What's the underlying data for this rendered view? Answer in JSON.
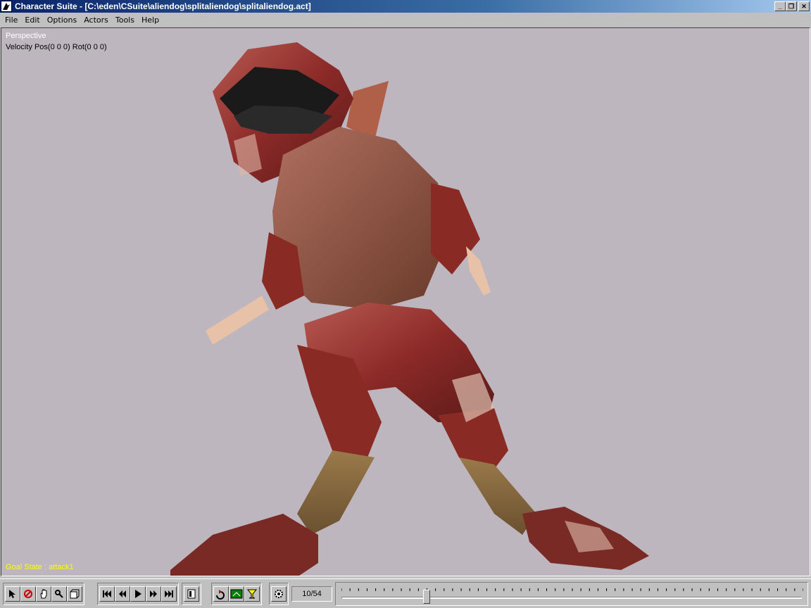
{
  "window": {
    "title": "Character Suite - [C:\\eden\\CSuite\\aliendog\\splitaliendog\\splitaliendog.act]",
    "icon": "character-suite-icon",
    "minimize": "_",
    "maximize": "❐",
    "close": "✕"
  },
  "menu": {
    "file": "File",
    "edit": "Edit",
    "options": "Options",
    "actors": "Actors",
    "tools": "Tools",
    "help": "Help"
  },
  "viewport": {
    "mode": "Perspective",
    "velocity": "Velocity Pos(0 0 0) Rot(0 0 0)",
    "goal_state": "Goal State : attack1",
    "background": "#beb6be"
  },
  "toolbar": {
    "frame_counter": "10/54",
    "tools": [
      "select-arrow-icon",
      "rotate-icon",
      "pan-hand-icon",
      "zoom-icon",
      "box-icon"
    ],
    "playback": [
      "first-frame-icon",
      "step-back-icon",
      "play-icon",
      "step-forward-icon",
      "last-frame-icon"
    ],
    "timeline_progress": 0.185
  }
}
